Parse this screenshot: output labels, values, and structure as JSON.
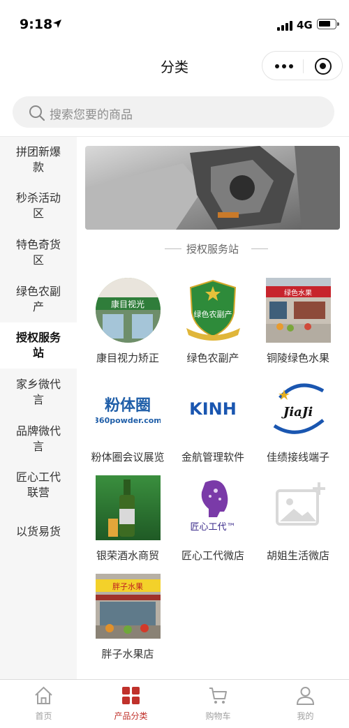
{
  "status_bar": {
    "time": "9:18",
    "network": "4G"
  },
  "nav": {
    "title": "分类"
  },
  "search": {
    "placeholder": "搜索您要的商品"
  },
  "sidebar": {
    "items": [
      {
        "label": "拼团新爆款",
        "active": false
      },
      {
        "label": "秒杀活动区",
        "active": false
      },
      {
        "label": "特色奇货区",
        "active": false
      },
      {
        "label": "绿色农副产",
        "active": false
      },
      {
        "label": "授权服务站",
        "active": true
      },
      {
        "label": "家乡微代言",
        "active": false
      },
      {
        "label": "品牌微代言",
        "active": false
      },
      {
        "label": "匠心工代联营",
        "active": false
      },
      {
        "label": "以货易货",
        "active": false
      }
    ]
  },
  "section": {
    "title": "授权服务站"
  },
  "stores": [
    {
      "name": "康目视力矫正",
      "thumb_text": "康目视光",
      "icon": "storefront-photo"
    },
    {
      "name": "绿色农副产",
      "thumb_text": "绿色农副产",
      "icon": "green-shield-logo"
    },
    {
      "name": "铜陵绿色水果",
      "thumb_text": "绿色水果",
      "icon": "fruit-store-photo"
    },
    {
      "name": "粉体圈会议展览",
      "thumb_text": "粉体圈",
      "thumb_subtext": "360powder.com",
      "icon": "powder-logo"
    },
    {
      "name": "金航管理软件",
      "thumb_text": "KINH",
      "icon": "kinh-logo"
    },
    {
      "name": "佳绩接线端子",
      "thumb_text": "JiaJi",
      "icon": "jiaji-logo"
    },
    {
      "name": "银荣酒水商贸",
      "icon": "beer-bottle-photo"
    },
    {
      "name": "匠心工代微店",
      "thumb_text": "匠心工代™",
      "icon": "craftsman-logo"
    },
    {
      "name": "胡姐生活微店",
      "icon": "image-placeholder-icon"
    },
    {
      "name": "胖子水果店",
      "thumb_text": "胖子水果",
      "icon": "fruit-shop-photo"
    }
  ],
  "tabbar": {
    "tabs": [
      {
        "label": "首页",
        "icon": "home-icon",
        "active": false
      },
      {
        "label": "产品分类",
        "icon": "category-grid-icon",
        "active": true
      },
      {
        "label": "购物车",
        "icon": "cart-icon",
        "active": false
      },
      {
        "label": "我的",
        "icon": "user-icon",
        "active": false
      }
    ]
  },
  "colors": {
    "accent": "#c0312b",
    "sidebar_bg": "#f6f6f6",
    "search_bg": "#f1f1f1"
  }
}
